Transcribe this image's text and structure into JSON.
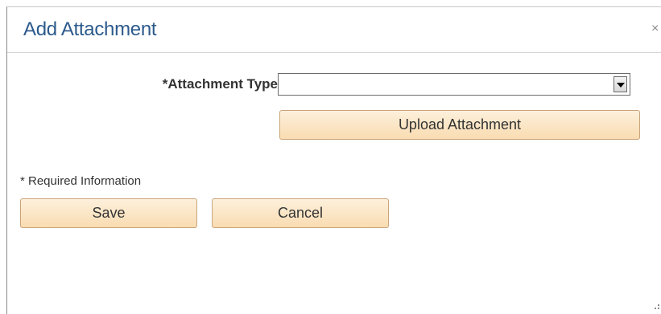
{
  "dialog": {
    "title": "Add Attachment",
    "close_glyph": "×"
  },
  "form": {
    "attachment_type_label": "*Attachment Type",
    "attachment_type_value": "",
    "upload_button_label": "Upload Attachment",
    "required_note": "* Required Information"
  },
  "actions": {
    "save_label": "Save",
    "cancel_label": "Cancel"
  },
  "icons": {
    "close": "close-icon",
    "dropdown": "chevron-down-icon",
    "resize": "resize-grip-icon"
  },
  "colors": {
    "title": "#2c5a8c",
    "button_top": "#fdf0dc",
    "button_bottom": "#f9dcb1",
    "button_border": "#c9a47a"
  }
}
